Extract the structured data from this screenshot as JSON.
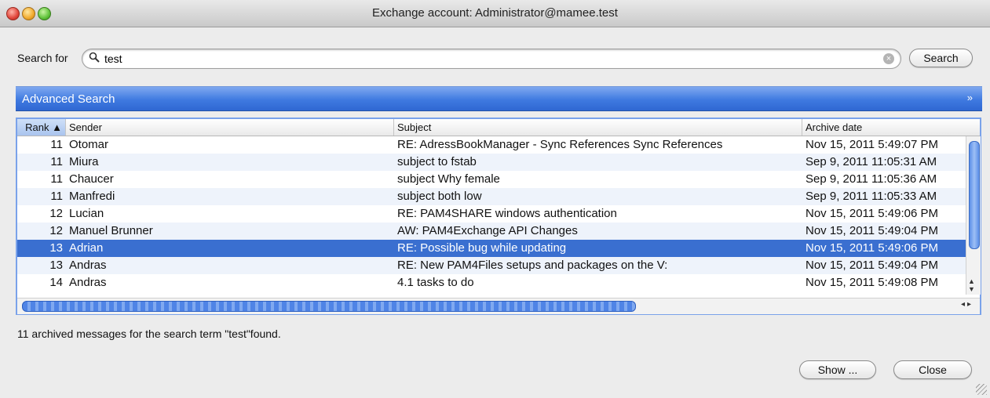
{
  "window": {
    "title": "Exchange account: Administrator@mamee.test",
    "controls": [
      "close",
      "minimize",
      "zoom"
    ]
  },
  "search": {
    "label": "Search for",
    "value": "test",
    "icon": "magnifier-icon",
    "button_label": "Search"
  },
  "advanced": {
    "label": "Advanced Search",
    "chevron": "»"
  },
  "table": {
    "columns": [
      {
        "label": "Rank",
        "sort": "ascending"
      },
      {
        "label": "Sender"
      },
      {
        "label": "Subject"
      },
      {
        "label": "Archive date"
      }
    ],
    "sort_indicator": "▲",
    "rows": [
      {
        "rank": "11",
        "sender": "Otomar",
        "subject": "RE: AdressBookManager - Sync References      Sync References",
        "date": "Nov 15, 2011 5:49:07 PM"
      },
      {
        "rank": "11",
        "sender": "Miura",
        "subject": "subject to fstab",
        "date": "Sep 9, 2011 11:05:31 AM"
      },
      {
        "rank": "11",
        "sender": "Chaucer",
        "subject": "subject Why female",
        "date": "Sep 9, 2011 11:05:36 AM"
      },
      {
        "rank": "11",
        "sender": "Manfredi",
        "subject": "subject both low",
        "date": "Sep 9, 2011 11:05:33 AM"
      },
      {
        "rank": "12",
        "sender": "Lucian",
        "subject": "RE: PAM4SHARE windows authentication",
        "date": "Nov 15, 2011 5:49:06 PM"
      },
      {
        "rank": "12",
        "sender": "Manuel Brunner",
        "subject": "AW: PAM4Exchange API Changes",
        "date": "Nov 15, 2011 5:49:04 PM"
      },
      {
        "rank": "13",
        "sender": "Adrian",
        "subject": "RE: Possible bug while updating",
        "date": "Nov 15, 2011 5:49:06 PM"
      },
      {
        "rank": "13",
        "sender": "Andras",
        "subject": "RE: New PAM4Files setups and packages on the V:",
        "date": "Nov 15, 2011 5:49:04 PM"
      },
      {
        "rank": "14",
        "sender": "Andras",
        "subject": "4.1 tasks to do",
        "date": "Nov 15, 2011 5:49:08 PM"
      }
    ],
    "selected_row": 6
  },
  "status": {
    "text": "11 archived messages for the search term \"test\"found."
  },
  "buttons": {
    "show": "Show ...",
    "close": "Close"
  },
  "colors": {
    "accent": "#3a6fd0",
    "advanced_bar": "#3f7ae0",
    "window_bg": "#ececec"
  }
}
